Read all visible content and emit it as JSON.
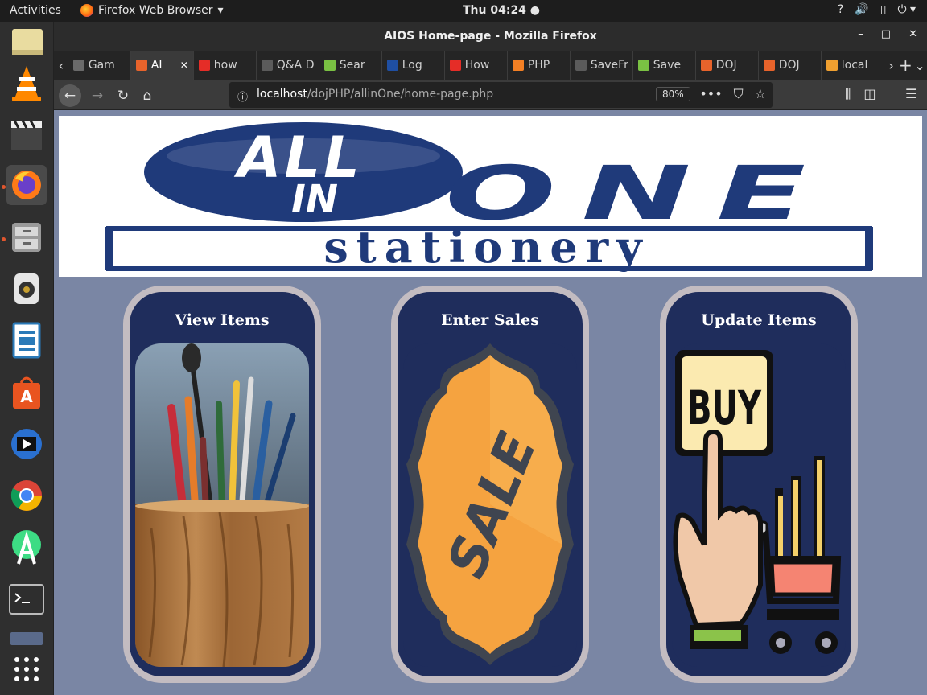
{
  "system": {
    "activities": "Activities",
    "app_menu": "Firefox Web Browser",
    "clock": "Thu 04:24"
  },
  "window": {
    "title": "AIOS Home-page - Mozilla Firefox"
  },
  "tabs": [
    {
      "label": "Gam",
      "color": "#6a6a6a"
    },
    {
      "label": "AI",
      "color": "#e8632b",
      "active": true
    },
    {
      "label": "how",
      "color": "#e52d27"
    },
    {
      "label": "Q&A Dis",
      "color": "#5b5b5b"
    },
    {
      "label": "Sear",
      "color": "#7ac143"
    },
    {
      "label": "Log",
      "color": "#1f4fa3"
    },
    {
      "label": "How",
      "color": "#e52d27"
    },
    {
      "label": "PHP",
      "color": "#f48024"
    },
    {
      "label": "SaveFro",
      "color": "#5b5b5b"
    },
    {
      "label": "Save",
      "color": "#7ac143"
    },
    {
      "label": "DOJ",
      "color": "#e8632b"
    },
    {
      "label": "DOJ",
      "color": "#e8632b"
    },
    {
      "label": "local",
      "color": "#f0a030"
    }
  ],
  "navbar": {
    "url_host": "localhost",
    "url_path": "/dojPHP/allinOne/home-page.php",
    "zoom": "80%"
  },
  "banner": {
    "logo_all": "ALL",
    "logo_in": "IN",
    "logo_one": "ONE",
    "tagline": "stationery"
  },
  "cards": [
    {
      "title": "View Items"
    },
    {
      "title": "Enter Sales",
      "badge_text": "SALE"
    },
    {
      "title": "Update Items",
      "sign_text": "BUY"
    }
  ],
  "colors": {
    "page_bg": "#7a86a4",
    "card_bg": "#1f2d5c",
    "card_border": "#c3bcc1",
    "logo_blue": "#1f3a7a",
    "sale_orange": "#f5a340"
  }
}
